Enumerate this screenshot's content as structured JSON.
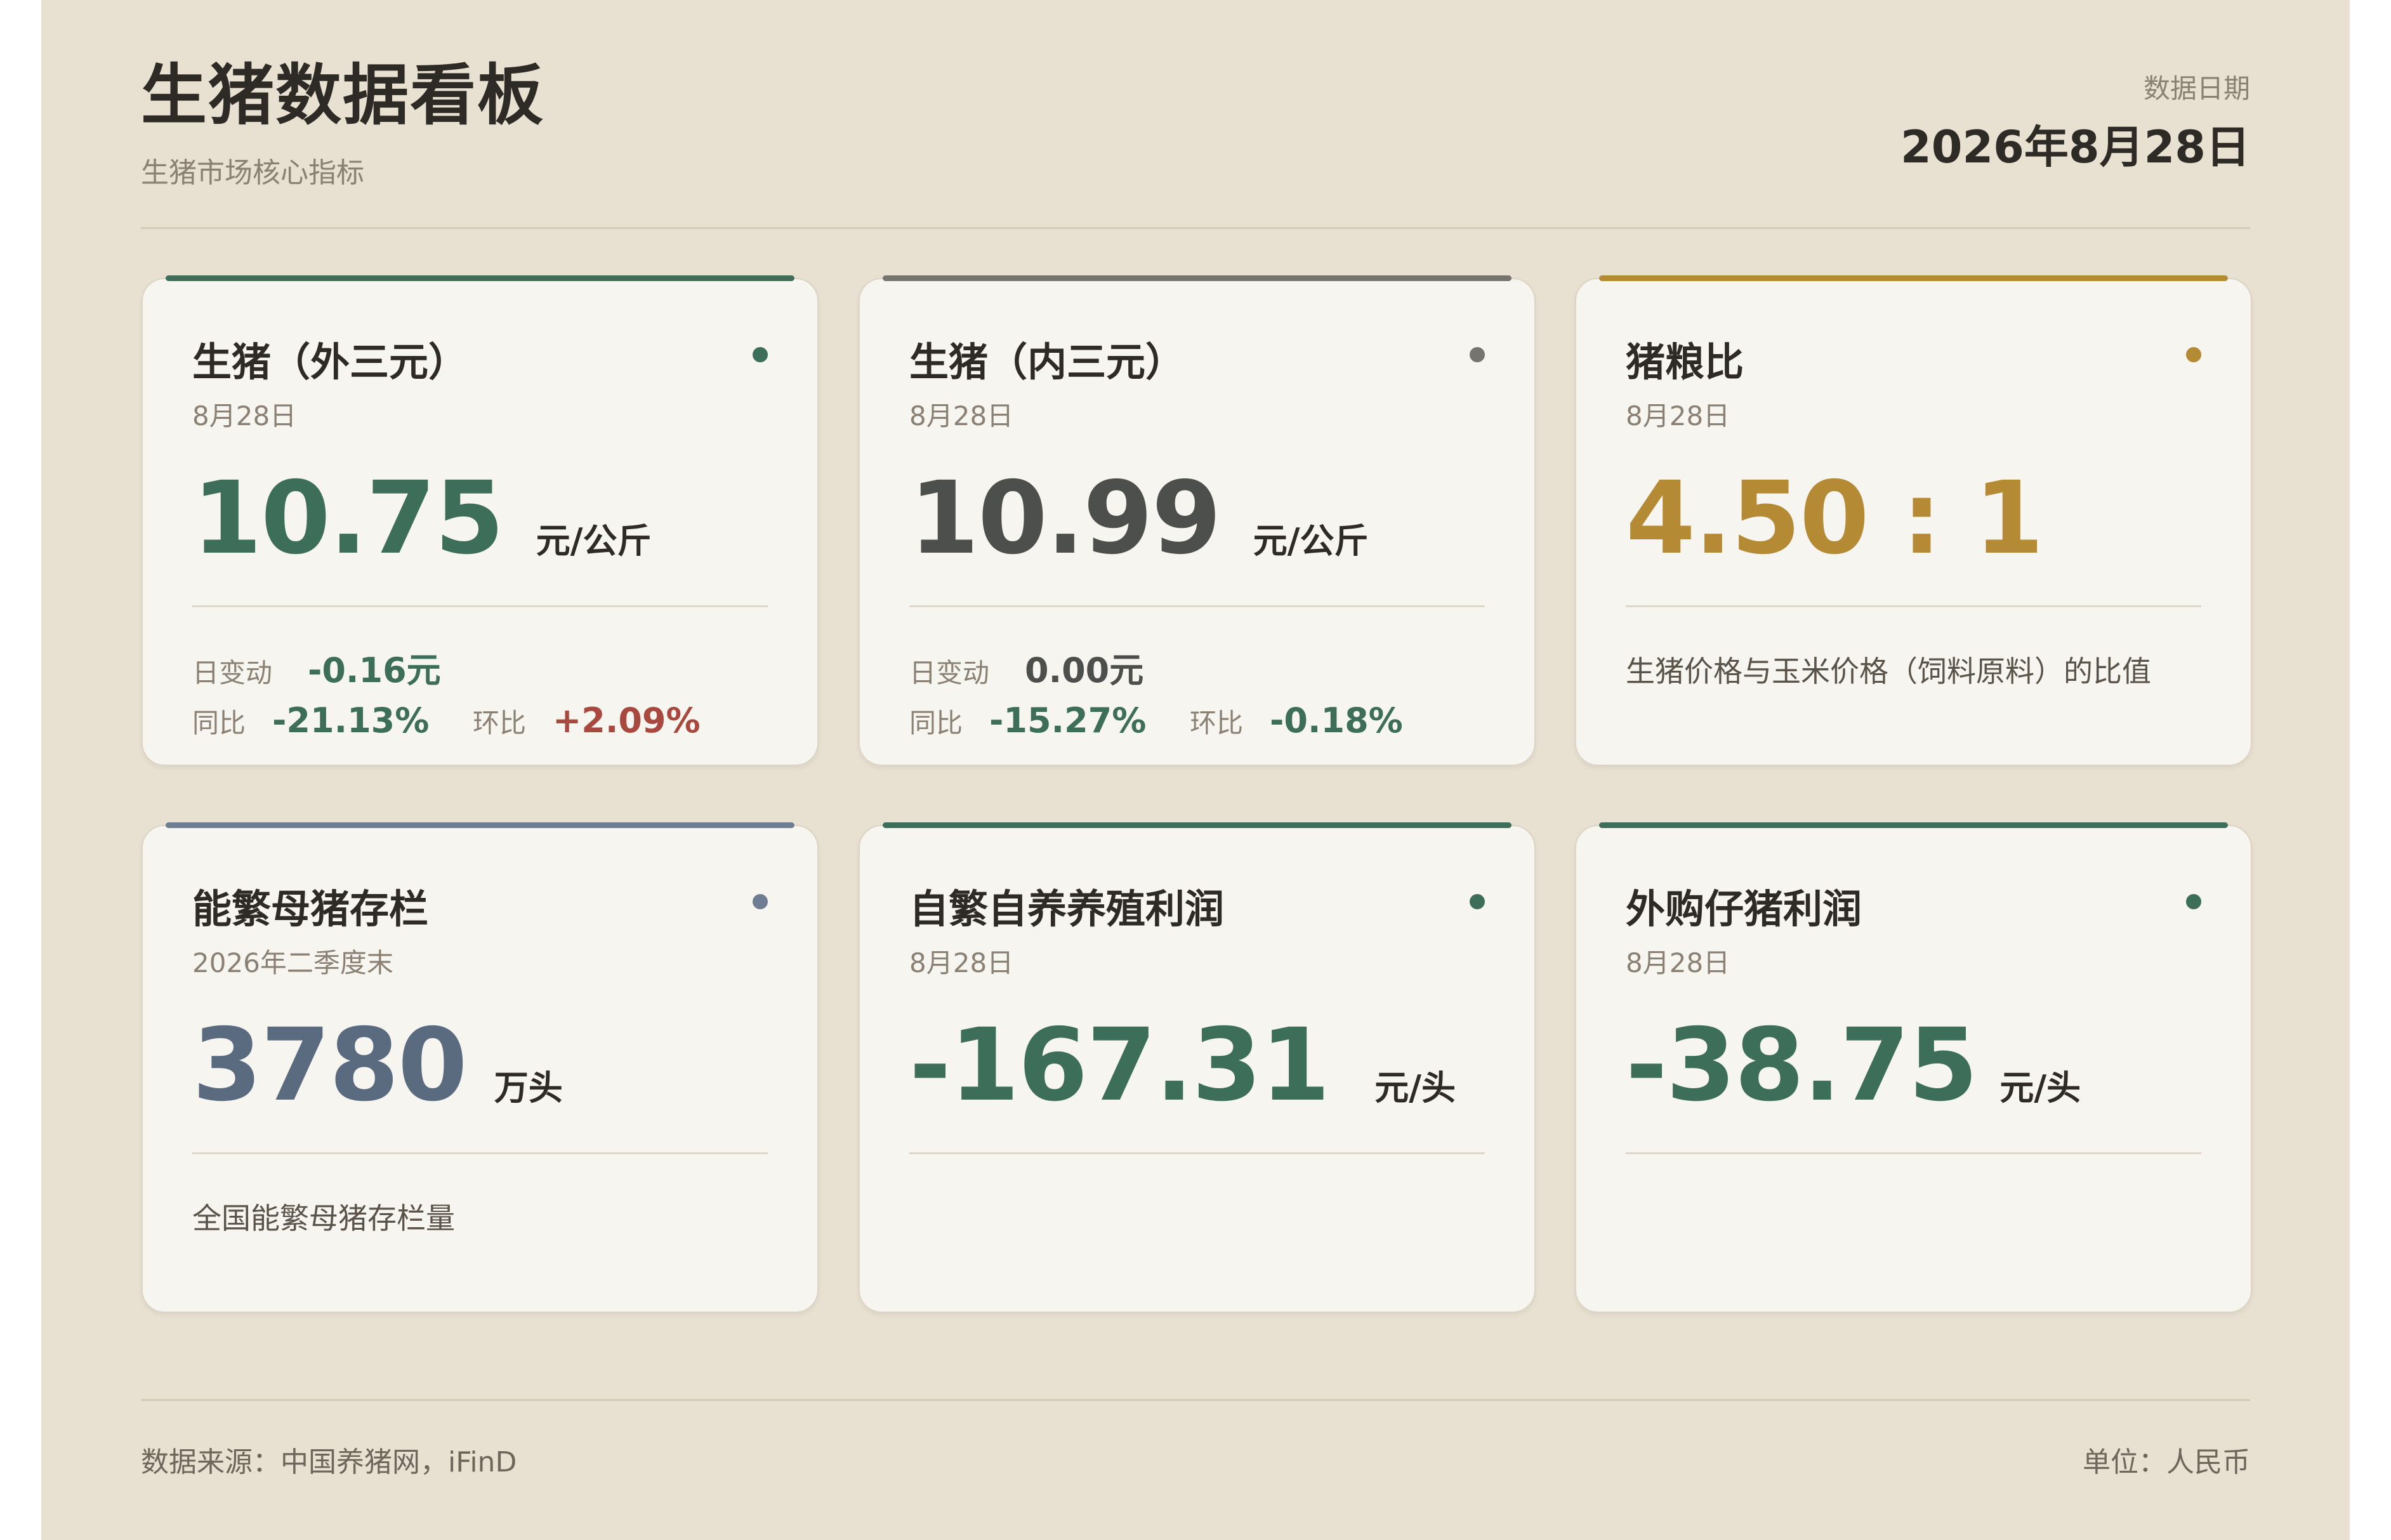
{
  "header": {
    "title": "生猪数据看板",
    "subtitle": "生猪市场核心指标",
    "date_label": "数据日期",
    "date_value": "2026年8月28日"
  },
  "cards": [
    {
      "title": "生猪（外三元）",
      "date": "8月28日",
      "value": "10.75",
      "unit": "元/公斤",
      "accent_color": "#3d6e5a",
      "daily_label": "日变动",
      "daily_value": "-0.16元",
      "yoy_label": "同比",
      "yoy_value": "-21.13%",
      "mom_label": "环比",
      "mom_value": "+2.09%"
    },
    {
      "title": "生猪（内三元）",
      "date": "8月28日",
      "value": "10.99",
      "unit": "元/公斤",
      "accent_color": "#76746e",
      "daily_label": "日变动",
      "daily_value": "0.00元",
      "yoy_label": "同比",
      "yoy_value": "-15.27%",
      "mom_label": "环比",
      "mom_value": "-0.18%"
    },
    {
      "title": "猪粮比",
      "date": "8月28日",
      "value": "4.50 : 1",
      "accent_color": "#b58a35",
      "description": "生猪价格与玉米价格（饲料原料）的比值"
    },
    {
      "title": "能繁母猪存栏",
      "date": "2026年二季度末",
      "value": "3780",
      "unit": "万头",
      "accent_color": "#6e7d92",
      "description": "全国能繁母猪存栏量"
    },
    {
      "title": "自繁自养养殖利润",
      "date": "8月28日",
      "value": "-167.31",
      "unit": "元/头",
      "accent_color": "#3d6e5a"
    },
    {
      "title": "外购仔猪利润",
      "date": "8月28日",
      "value": "-38.75",
      "unit": "元/头",
      "accent_color": "#3d6e5a"
    }
  ],
  "footer": {
    "source": "数据来源：中国养猪网，iFinD",
    "unit": "单位：人民币"
  }
}
